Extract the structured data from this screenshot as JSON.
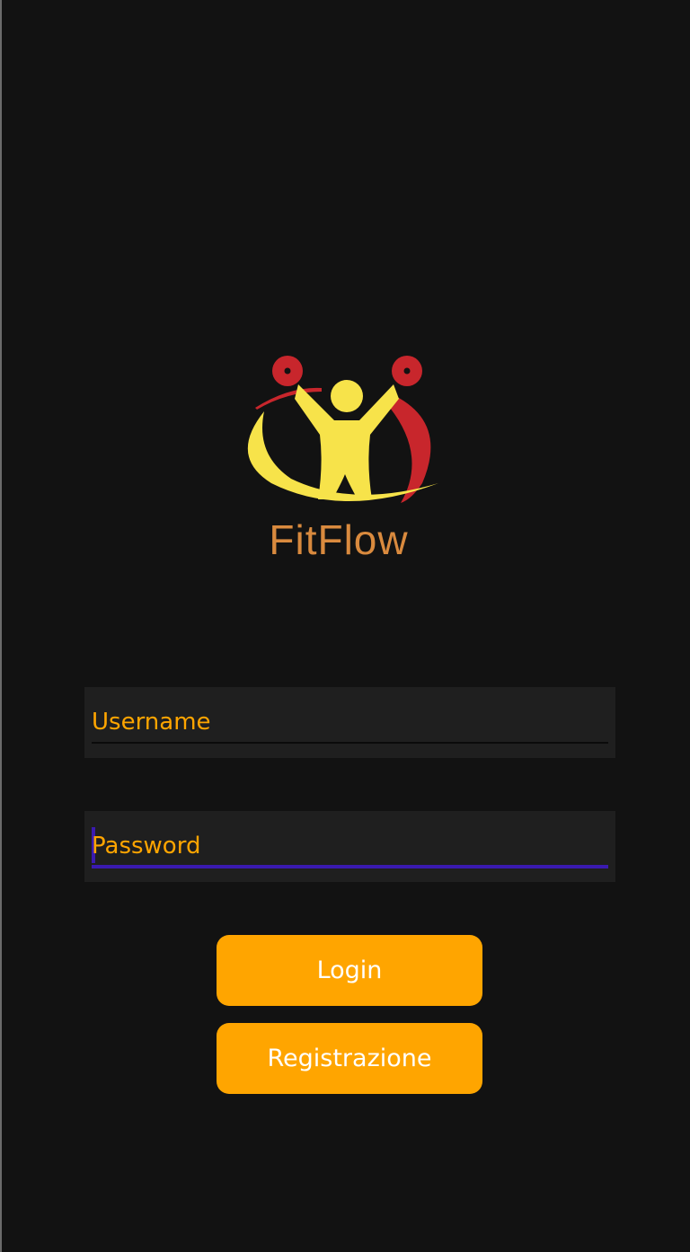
{
  "app": {
    "logo_text": "FitFlow",
    "logo_icon": "weightlifter-logo-icon"
  },
  "form": {
    "username": {
      "placeholder": "Username",
      "value": ""
    },
    "password": {
      "placeholder": "Password",
      "value": ""
    }
  },
  "actions": {
    "login_label": "Login",
    "register_label": "Registrazione"
  },
  "colors": {
    "background": "#121212",
    "field_background": "#1f1f1f",
    "accent": "#ffa500",
    "focus": "#3a1ab0",
    "logo_yellow": "#f7e34a",
    "logo_red": "#c8262c",
    "logo_text": "#d98a3e"
  }
}
